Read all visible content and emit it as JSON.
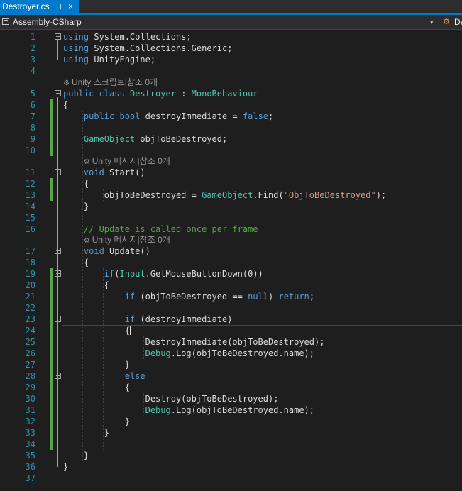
{
  "tab": {
    "title": "Destroyer.cs",
    "pin_glyph": "⊣",
    "close_glyph": "×"
  },
  "navbar": {
    "project": "Assembly-CSharp",
    "dropdown_glyph": "▾",
    "member": "De"
  },
  "hints": {
    "class": "Unity 스크립트|참조 0개",
    "start": "Unity 메시지|참조 0개",
    "update": "Unity 메시지|참조 0개"
  },
  "lines": [
    {
      "n": "1",
      "tokens": [
        {
          "c": "k",
          "t": "using"
        },
        {
          "c": "",
          "t": " System.Collections;"
        }
      ]
    },
    {
      "n": "2",
      "tokens": [
        {
          "c": "k",
          "t": "using"
        },
        {
          "c": "",
          "t": " System.Collections.Generic;"
        }
      ]
    },
    {
      "n": "3",
      "tokens": [
        {
          "c": "k",
          "t": "using"
        },
        {
          "c": "",
          "t": " UnityEngine;"
        }
      ]
    },
    {
      "n": "4",
      "tokens": []
    },
    {
      "n": "5",
      "tokens": [
        {
          "c": "k",
          "t": "public class"
        },
        {
          "c": "",
          "t": " "
        },
        {
          "c": "t",
          "t": "Destroyer"
        },
        {
          "c": "",
          "t": " : "
        },
        {
          "c": "t",
          "t": "MonoBehaviour"
        }
      ]
    },
    {
      "n": "6",
      "tokens": [
        {
          "c": "",
          "t": "{"
        }
      ]
    },
    {
      "n": "7",
      "tokens": [
        {
          "c": "",
          "t": "    "
        },
        {
          "c": "k",
          "t": "public bool"
        },
        {
          "c": "",
          "t": " destroyImmediate = "
        },
        {
          "c": "k",
          "t": "false"
        },
        {
          "c": "",
          "t": ";"
        }
      ]
    },
    {
      "n": "8",
      "tokens": []
    },
    {
      "n": "9",
      "tokens": [
        {
          "c": "",
          "t": "    "
        },
        {
          "c": "t",
          "t": "GameObject"
        },
        {
          "c": "",
          "t": " objToBeDestroyed;"
        }
      ]
    },
    {
      "n": "10",
      "tokens": []
    },
    {
      "n": "11",
      "tokens": [
        {
          "c": "",
          "t": "    "
        },
        {
          "c": "k",
          "t": "void"
        },
        {
          "c": "",
          "t": " Start()"
        }
      ]
    },
    {
      "n": "12",
      "tokens": [
        {
          "c": "",
          "t": "    {"
        }
      ]
    },
    {
      "n": "13",
      "tokens": [
        {
          "c": "",
          "t": "        objToBeDestroyed = "
        },
        {
          "c": "t",
          "t": "GameObject"
        },
        {
          "c": "",
          "t": ".Find("
        },
        {
          "c": "s",
          "t": "\"ObjToBeDestroyed\""
        },
        {
          "c": "",
          "t": ");"
        }
      ]
    },
    {
      "n": "14",
      "tokens": [
        {
          "c": "",
          "t": "    }"
        }
      ]
    },
    {
      "n": "15",
      "tokens": []
    },
    {
      "n": "16",
      "tokens": [
        {
          "c": "",
          "t": "    "
        },
        {
          "c": "c",
          "t": "// Update is called once per frame"
        }
      ]
    },
    {
      "n": "17",
      "tokens": [
        {
          "c": "",
          "t": "    "
        },
        {
          "c": "k",
          "t": "void"
        },
        {
          "c": "",
          "t": " Update()"
        }
      ]
    },
    {
      "n": "18",
      "tokens": [
        {
          "c": "",
          "t": "    {"
        }
      ]
    },
    {
      "n": "19",
      "tokens": [
        {
          "c": "",
          "t": "        "
        },
        {
          "c": "k",
          "t": "if"
        },
        {
          "c": "",
          "t": "("
        },
        {
          "c": "t",
          "t": "Input"
        },
        {
          "c": "",
          "t": ".GetMouseButtonDown(0))"
        }
      ]
    },
    {
      "n": "20",
      "tokens": [
        {
          "c": "",
          "t": "        {"
        }
      ]
    },
    {
      "n": "21",
      "tokens": [
        {
          "c": "",
          "t": "            "
        },
        {
          "c": "k",
          "t": "if"
        },
        {
          "c": "",
          "t": " (objToBeDestroyed == "
        },
        {
          "c": "k",
          "t": "null"
        },
        {
          "c": "",
          "t": ") "
        },
        {
          "c": "k",
          "t": "return"
        },
        {
          "c": "",
          "t": ";"
        }
      ]
    },
    {
      "n": "22",
      "tokens": []
    },
    {
      "n": "23",
      "tokens": [
        {
          "c": "",
          "t": "            "
        },
        {
          "c": "k",
          "t": "if"
        },
        {
          "c": "",
          "t": " (destroyImmediate)"
        }
      ]
    },
    {
      "n": "24",
      "tokens": [
        {
          "c": "",
          "t": "            {"
        }
      ]
    },
    {
      "n": "25",
      "tokens": [
        {
          "c": "",
          "t": "                DestroyImmediate(objToBeDestroyed);"
        }
      ]
    },
    {
      "n": "26",
      "tokens": [
        {
          "c": "",
          "t": "                "
        },
        {
          "c": "t",
          "t": "Debug"
        },
        {
          "c": "",
          "t": ".Log(objToBeDestroyed.name);"
        }
      ]
    },
    {
      "n": "27",
      "tokens": [
        {
          "c": "",
          "t": "            }"
        }
      ]
    },
    {
      "n": "28",
      "tokens": [
        {
          "c": "",
          "t": "            "
        },
        {
          "c": "k",
          "t": "else"
        }
      ]
    },
    {
      "n": "29",
      "tokens": [
        {
          "c": "",
          "t": "            {"
        }
      ]
    },
    {
      "n": "30",
      "tokens": [
        {
          "c": "",
          "t": "                Destroy(objToBeDestroyed);"
        }
      ]
    },
    {
      "n": "31",
      "tokens": [
        {
          "c": "",
          "t": "                "
        },
        {
          "c": "t",
          "t": "Debug"
        },
        {
          "c": "",
          "t": ".Log(objToBeDestroyed.name);"
        }
      ]
    },
    {
      "n": "32",
      "tokens": [
        {
          "c": "",
          "t": "            }"
        }
      ]
    },
    {
      "n": "33",
      "tokens": [
        {
          "c": "",
          "t": "        }"
        }
      ]
    },
    {
      "n": "34",
      "tokens": []
    },
    {
      "n": "35",
      "tokens": [
        {
          "c": "",
          "t": "    }"
        }
      ]
    },
    {
      "n": "36",
      "tokens": [
        {
          "c": "",
          "t": "}"
        }
      ]
    },
    {
      "n": "37",
      "tokens": []
    }
  ],
  "colors": {
    "keyword": "#569cd6",
    "type": "#4ec9b0",
    "string": "#d69d85",
    "comment": "#57a64a",
    "line_number": "#2b91af",
    "change_bar": "#57a64a",
    "accent": "#007acc",
    "background": "#1e1e1e"
  }
}
